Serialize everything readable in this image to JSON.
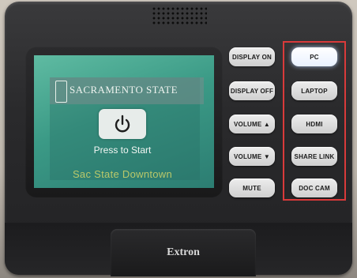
{
  "screen": {
    "logo_text": "SACRAMENTO STATE",
    "power_button": {
      "icon": "power-icon"
    },
    "prompt": "Press to Start",
    "location": "Sac State Downtown"
  },
  "left_buttons": [
    {
      "label": "DISPLAY ON"
    },
    {
      "label": "DISPLAY OFF"
    },
    {
      "label": "VOLUME ▲"
    },
    {
      "label": "VOLUME ▼"
    },
    {
      "label": "MUTE"
    }
  ],
  "source_buttons": [
    {
      "label": "PC",
      "lit": true
    },
    {
      "label": "LAPTOP",
      "lit": false
    },
    {
      "label": "HDMI",
      "lit": false
    },
    {
      "label": "SHARE LINK",
      "lit": false
    },
    {
      "label": "DOC CAM",
      "lit": false
    }
  ],
  "brand": "Extron",
  "colors": {
    "screen": "#3b9a86",
    "highlight": "#d93a3a",
    "location_text": "#b9c86a"
  }
}
